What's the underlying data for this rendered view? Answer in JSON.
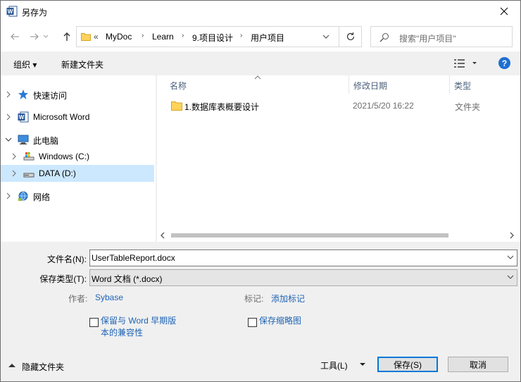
{
  "window": {
    "title": "另存为",
    "app_icon": "word-icon"
  },
  "address": {
    "overflow": "«",
    "crumbs": [
      "MyDoc",
      "Learn",
      "9.项目设计",
      "用户项目"
    ]
  },
  "search": {
    "placeholder": "搜索\"用户项目\""
  },
  "toolbar": {
    "organize": "组织 ▾",
    "new_folder": "新建文件夹",
    "help": "?"
  },
  "navpane": {
    "items": [
      {
        "label": "快速访问",
        "icon": "star-icon"
      },
      {
        "label": "Microsoft Word",
        "icon": "word-icon"
      },
      {
        "label": "此电脑",
        "icon": "computer-icon"
      },
      {
        "label": "Windows (C:)",
        "icon": "drive-c-icon"
      },
      {
        "label": "DATA (D:)",
        "icon": "drive-icon"
      },
      {
        "label": "网络",
        "icon": "network-icon"
      }
    ]
  },
  "filelist": {
    "columns": [
      "名称",
      "修改日期",
      "类型"
    ],
    "rows": [
      {
        "name": "1.数据库表概要设计",
        "modified": "2021/5/20 16:22",
        "type": "文件夹"
      }
    ]
  },
  "form": {
    "filename_label": "文件名(N):",
    "filename_value": "UserTableReport.docx",
    "filetype_label": "保存类型(T):",
    "filetype_value": "Word 文档 (*.docx)",
    "author_label": "作者:",
    "author_value": "Sybase",
    "tags_label": "标记:",
    "tags_value": "添加标记",
    "compat_line1": "保留与 Word 早期版",
    "compat_line2": "本的兼容性",
    "thumbnail_label": "保存缩略图"
  },
  "footer": {
    "hide_folders": "隐藏文件夹",
    "tools": "工具(L)",
    "save": "保存(S)",
    "cancel": "取消"
  },
  "colors": {
    "accent": "#0078d7",
    "selection": "#cce8ff",
    "link": "#1e63b5",
    "help": "#1e6fd3"
  }
}
